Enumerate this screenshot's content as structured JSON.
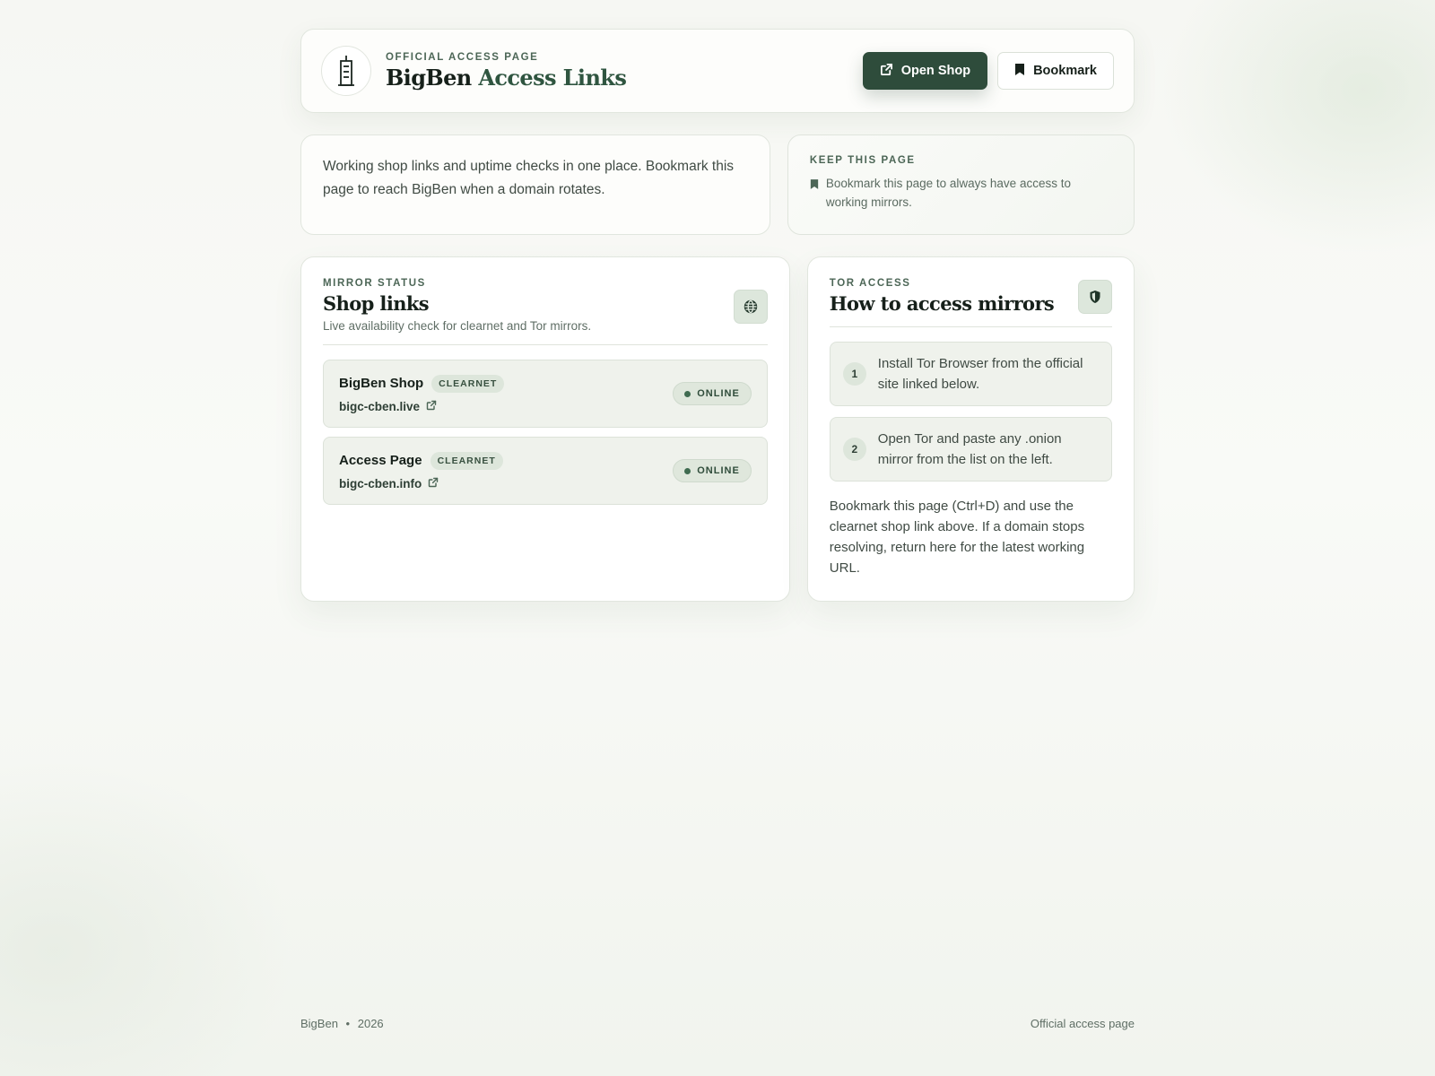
{
  "header": {
    "eyebrow": "OFFICIAL ACCESS PAGE",
    "title_part1": "BigBen",
    "title_part2": "Access Links",
    "open_shop_label": "Open Shop",
    "bookmark_label": "Bookmark"
  },
  "intro": {
    "text": "Working shop links and uptime checks in one place. Bookmark this page to reach BigBen when a domain rotates."
  },
  "keep": {
    "heading": "KEEP THIS PAGE",
    "text": "Bookmark this page to always have access to working mirrors."
  },
  "shop": {
    "eyebrow": "MIRROR STATUS",
    "title": "Shop links",
    "subtitle": "Live availability check for clearnet and Tor mirrors.",
    "links": [
      {
        "name": "BigBen Shop",
        "tag": "CLEARNET",
        "url": "bigc-cben.live",
        "status": "ONLINE"
      },
      {
        "name": "Access Page",
        "tag": "CLEARNET",
        "url": "bigc-cben.info",
        "status": "ONLINE"
      }
    ]
  },
  "tor": {
    "eyebrow": "TOR ACCESS",
    "title": "How to access mirrors",
    "steps": [
      {
        "num": "1",
        "text": "Install Tor Browser from the official site linked below."
      },
      {
        "num": "2",
        "text": "Open Tor and paste any .onion mirror from the list on the left."
      }
    ],
    "note": "Bookmark this page (Ctrl+D) and use the clearnet shop link above. If a domain stops resolving, return here for the latest working URL."
  },
  "footer": {
    "brand": "BigBen",
    "separator": "•",
    "year": "2026",
    "right": "Official access page"
  },
  "colors": {
    "accent": "#2e4c3b",
    "accent_light": "#dde7dc",
    "row_bg": "#eff2ec"
  }
}
